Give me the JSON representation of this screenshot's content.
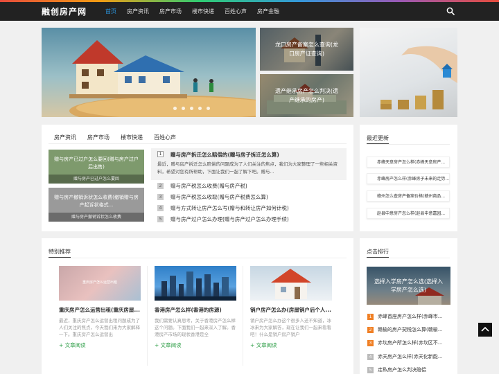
{
  "site": {
    "logo": "融创房产网"
  },
  "nav": {
    "items": [
      "首页",
      "房产资讯",
      "房产市场",
      "楼市快递",
      "百姓心声",
      "房产金融"
    ],
    "active_index": 0
  },
  "slides": [
    {
      "caption": "龙口房产备案怎么查询(龙口房产证查询)"
    },
    {
      "caption": "遗产继承房产怎么判决(遗产继承的房产)"
    }
  ],
  "content_tabs": [
    "房产资讯",
    "房产市场",
    "楼市快递",
    "百姓心声"
  ],
  "news_cards": [
    {
      "title": "赠与房产已过户怎么要回(赠与房产过户后出售)",
      "sub": "赠与房产已过户怎么要回"
    },
    {
      "title": "赠与房产撤销诉状怎么收费(撤销赠与房产起诉状格式...",
      "sub": "赠与房产撤销诉状怎么收费"
    }
  ],
  "featured": {
    "title": "赠与房产拆迁怎么赔偿的(赠与房子拆迁怎么算)",
    "desc": "最近，赠与房产拆迁怎么赔偿的问题成为了人们关注的焦点，我们为大家整理了一些相关资料，希望对您有所帮助，下面让我们一起了解下吧。赠与..."
  },
  "news_list": [
    {
      "num": "2",
      "title": "赠与房产税怎么收费(赠与房产税)"
    },
    {
      "num": "3",
      "title": "赠与房产税怎么收取(赠与房产税费怎么算)"
    },
    {
      "num": "4",
      "title": "赠与方式转让房产怎么写(赠与和转让房产如何计税)"
    },
    {
      "num": "5",
      "title": "赠与房产过户怎么办理(赠与房产过户怎么办理手续)"
    }
  ],
  "recent": {
    "title": "最近更新",
    "items": [
      "赤峰天意房产怎么样(赤峰天意房产...",
      "赤峰房产怎么样(赤峰房子未来的走势...",
      "赣州怎么查房产备案价格(赣州商品...",
      "赵县中意房产怎么样(赵县中意嘉园..."
    ]
  },
  "special": {
    "title": "特别推荐",
    "more_label": "+ 文章阅读",
    "cards": [
      {
        "img_text": "重庆房产怎么运营出租",
        "title": "重庆房产怎么运营出租(重庆房屋...",
        "desc": "最近，重庆房产怎么运营出租问题成为了人们关注的焦点，今天我们来为大家解释一下。重庆房产怎么运营出"
      },
      {
        "img_text": "",
        "title": "香港房产怎么样(香港的房源)",
        "desc": "我们需要认真思考，关于香港房产怎么样这个问题。下面我们一起来深入了解。香港房产市场的现状香港是全"
      },
      {
        "img_text": "",
        "title": "销户房产怎么办(房屋销户后个人...",
        "desc": "销户房产怎么办这个很多人还不知道，冰冰来为大家解答，现在让我们一起来看看吧！什么是销户房产销户"
      }
    ]
  },
  "ranking": {
    "title": "点击排行",
    "img_caption": "选择入学房产怎么选(选择入学房产怎么选)",
    "items": [
      {
        "num": "1",
        "title": "赤峰首座房产怎么样(赤峰市..."
      },
      {
        "num": "2",
        "title": "赣榆的房产契税怎么算(赣榆..."
      },
      {
        "num": "3",
        "title": "赤坎房产所怎么样(赤坎区不..."
      },
      {
        "num": "4",
        "title": "赤天房产怎么样(赤天化新能..."
      },
      {
        "num": "5",
        "title": "走私房产怎么判决赔偿"
      }
    ]
  },
  "colors": {
    "nav_bg": "#222222",
    "nav_active": "#2b9be8",
    "more_link": "#2e9e47",
    "rank_hot": "#f07f24",
    "rank_normal": "#bbbbbb"
  }
}
